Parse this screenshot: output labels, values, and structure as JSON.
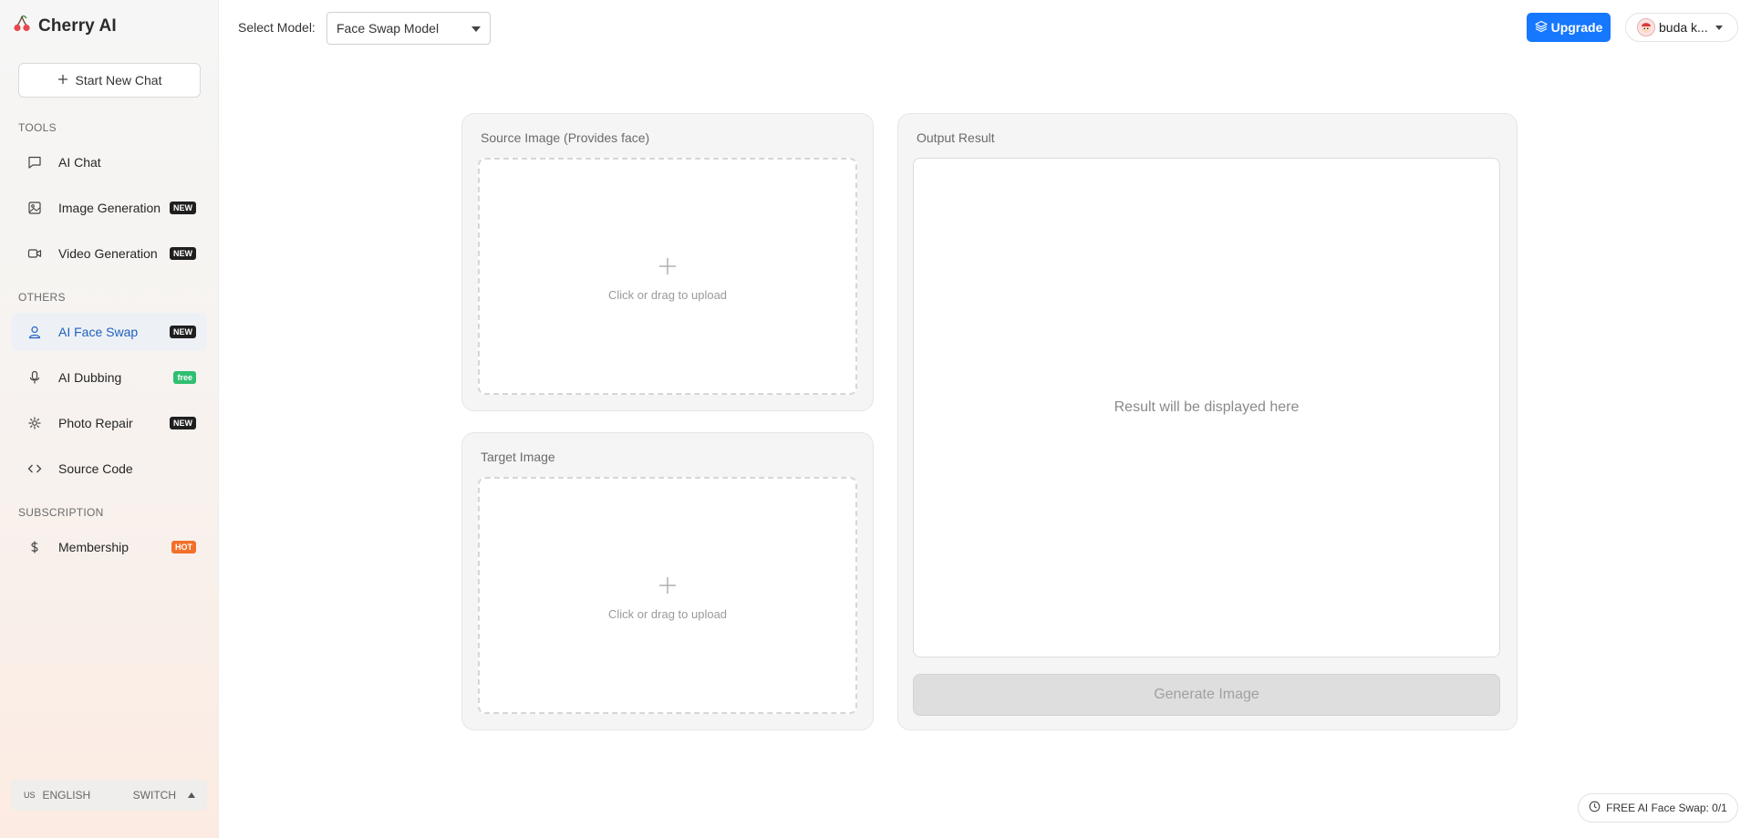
{
  "app": {
    "name": "Cherry AI"
  },
  "sidebar": {
    "new_chat_label": "Start New Chat",
    "sections": {
      "tools": "TOOLS",
      "others": "OTHERS",
      "subscription": "SUBSCRIPTION"
    },
    "items": [
      {
        "label": "AI Chat",
        "icon": "chat-icon"
      },
      {
        "label": "Image Generation",
        "icon": "image-icon",
        "badge": "NEW"
      },
      {
        "label": "Video Generation",
        "icon": "video-icon",
        "badge": "NEW"
      },
      {
        "label": "AI Face Swap",
        "icon": "user-icon",
        "badge": "NEW",
        "active": true
      },
      {
        "label": "AI Dubbing",
        "icon": "microphone-icon",
        "badge": "free"
      },
      {
        "label": "Photo Repair",
        "icon": "sparkle-icon",
        "badge": "NEW"
      },
      {
        "label": "Source Code",
        "icon": "code-icon"
      },
      {
        "label": "Membership",
        "icon": "dollar-icon",
        "badge": "HOT"
      }
    ],
    "language": {
      "flag": "US",
      "label": "ENGLISH",
      "switch_label": "SWITCH"
    }
  },
  "header": {
    "model_label": "Select Model:",
    "model_value": "Face Swap Model",
    "upgrade_label": "Upgrade",
    "user_name": "buda k..."
  },
  "main": {
    "source_card_title": "Source Image (Provides face)",
    "target_card_title": "Target Image",
    "upload_hint": "Click or drag to upload",
    "output_card_title": "Output Result",
    "result_placeholder": "Result will be displayed here",
    "generate_label": "Generate Image"
  },
  "footer": {
    "quota_label": "FREE AI Face Swap: 0/1"
  },
  "colors": {
    "accent": "#1677ff",
    "active_item": "#1f5fbf",
    "badge_new": "#1f1f1f",
    "badge_free": "#2fbf71",
    "badge_hot": "#f2702a"
  }
}
